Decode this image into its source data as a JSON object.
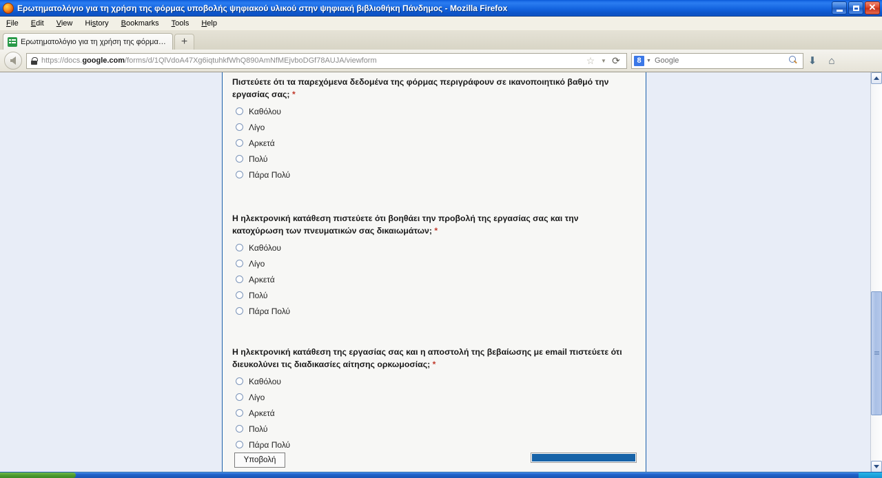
{
  "window": {
    "title": "Ερωτηματολόγιο για τη χρήση της φόρμας υποβολής ψηφιακού υλικού στην ψηφιακή βιβλιοθήκη Πάνδημος - Mozilla Firefox",
    "app_icon": "firefox-icon",
    "minimize_label": "",
    "maximize_label": "",
    "close_label": "✕"
  },
  "menubar": {
    "items": [
      {
        "label": "File"
      },
      {
        "label": "Edit"
      },
      {
        "label": "View"
      },
      {
        "label": "History"
      },
      {
        "label": "Bookmarks"
      },
      {
        "label": "Tools"
      },
      {
        "label": "Help"
      }
    ]
  },
  "tabs": {
    "active": {
      "title": "Ερωτηματολόγιο για τη χρήση της φόρμας υ...",
      "favicon": "google-forms-icon"
    },
    "new_tab_label": "+"
  },
  "toolbar": {
    "back_label": "",
    "url_prefix": "https://docs.",
    "url_domain": "google.com",
    "url_path": "/forms/d/1QlVdoA47Xg6iqtuhkfWhQ890AmNfMEjvboDGf78AUJA/viewform",
    "url_full": "https://docs.google.com/forms/d/1QlVdoA47Xg6iqtuhkfWhQ890AmNfMEjvboDGf78AUJA/viewform",
    "star_glyph": "☆",
    "caret_glyph": "▼",
    "reload_glyph": "⟳",
    "search_engine": "8",
    "search_caret": "▼",
    "search_placeholder": "Google",
    "download_glyph": "⬇",
    "home_glyph": "⌂"
  },
  "form": {
    "required_marker": "*",
    "questions": [
      {
        "text": "Πιστεύετε ότι τα παρεχόμενα δεδομένα της φόρμας περιγράφουν σε ικανοποιητικό βαθμό την εργασίας σας;",
        "required": true,
        "options": [
          "Καθόλου",
          "Λίγο",
          "Αρκετά",
          "Πολύ",
          "Πάρα Πολύ"
        ]
      },
      {
        "text": "Η ηλεκτρονική κατάθεση πιστεύετε ότι βοηθάει την προβολή της εργασίας σας και την κατοχύρωση των πνευματικών σας δικαιωμάτων;",
        "required": true,
        "options": [
          "Καθόλου",
          "Λίγο",
          "Αρκετά",
          "Πολύ",
          "Πάρα Πολύ"
        ]
      },
      {
        "text": "Η ηλεκτρονική κατάθεση της εργασίας σας και η αποστολή της βεβαίωσης με email πιστεύετε ότι διευκολύνει τις διαδικασίες αίτησης ορκωμοσίας;",
        "required": true,
        "options": [
          "Καθόλου",
          "Λίγο",
          "Αρκετά",
          "Πολύ",
          "Πάρα Πολύ"
        ]
      }
    ],
    "submit_label": "Υποβολή",
    "progress_percent": 100
  },
  "scrollbar": {
    "up_label": "",
    "down_label": ""
  },
  "colors": {
    "titlebar_blue": "#1464e0",
    "page_background": "#e8edf7",
    "card_background": "#f7f7f5",
    "card_border": "#1b5faa",
    "required_red": "#c0392b",
    "progress_blue": "#1763a8",
    "favicon_green": "#2a9a49",
    "start_green": "#4d9b2e"
  }
}
